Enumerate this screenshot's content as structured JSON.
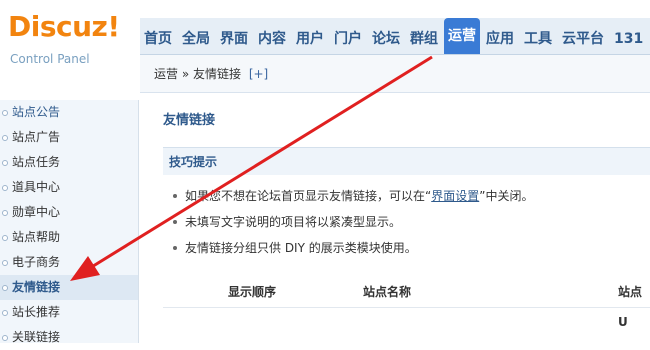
{
  "logo": {
    "brand": "Discuz!",
    "subtitle": "Control Panel"
  },
  "topnav": [
    "首页",
    "全局",
    "界面",
    "内容",
    "用户",
    "门户",
    "论坛",
    "群组",
    "运营",
    "应用",
    "工具",
    "云平台",
    "131"
  ],
  "active_nav": "运营",
  "breadcrumb": {
    "text": "运营 » 友情链接",
    "plus": "[+]"
  },
  "sidebar": [
    "站点公告",
    "站点广告",
    "站点任务",
    "道具中心",
    "勋章中心",
    "站点帮助",
    "电子商务",
    "友情链接",
    "站长推荐",
    "关联链接"
  ],
  "active_sidebar": "友情链接",
  "main": {
    "title": "友情链接",
    "tips_title": "技巧提示",
    "tips": {
      "t1_a": "如果您不想在论坛首页显示友情链接，可以在“",
      "t1_link": "界面设置",
      "t1_b": "”中关闭。",
      "t2": "未填写文字说明的项目将以紧凑型显示。",
      "t3": "友情链接分组只供 DIY 的展示类模块使用。"
    },
    "columns": [
      "显示顺序",
      "站点名称",
      "站点 U"
    ]
  },
  "colors": {
    "accent": "#3a7bd5",
    "arrow": "#e02020",
    "logo": "#f2840f"
  }
}
